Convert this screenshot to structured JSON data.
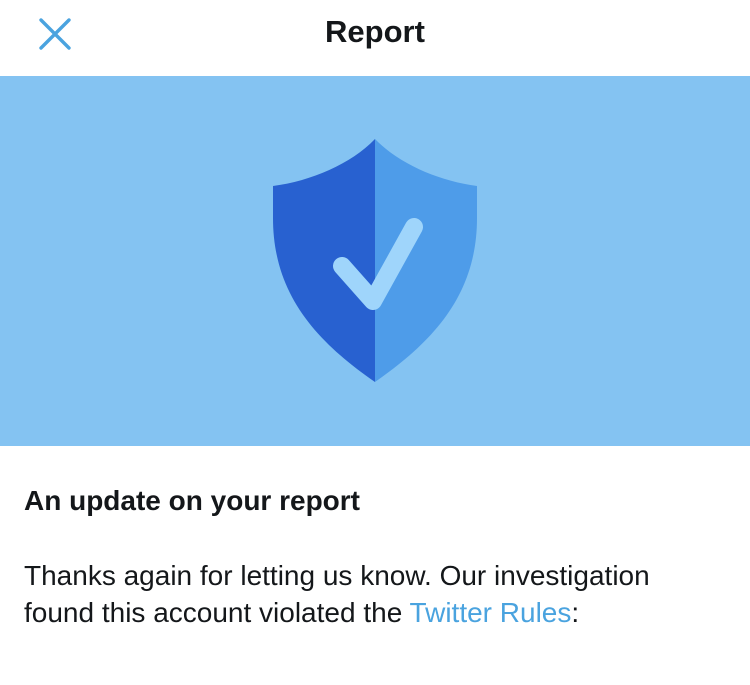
{
  "header": {
    "title": "Report",
    "close_icon": "close-icon"
  },
  "banner": {
    "icon": "shield-check-icon",
    "colors": {
      "background": "#84c3f2",
      "shield_dark": "#2861d0",
      "shield_light": "#4e9ce9",
      "check": "#9fd5fb"
    }
  },
  "content": {
    "heading": "An update on your report",
    "paragraph_start": "Thanks again for letting us know. Our investigation found this account violated the ",
    "link_text": "Twitter Rules",
    "paragraph_end": ":"
  },
  "colors": {
    "accent": "#4aa3df",
    "text": "#14171a"
  }
}
